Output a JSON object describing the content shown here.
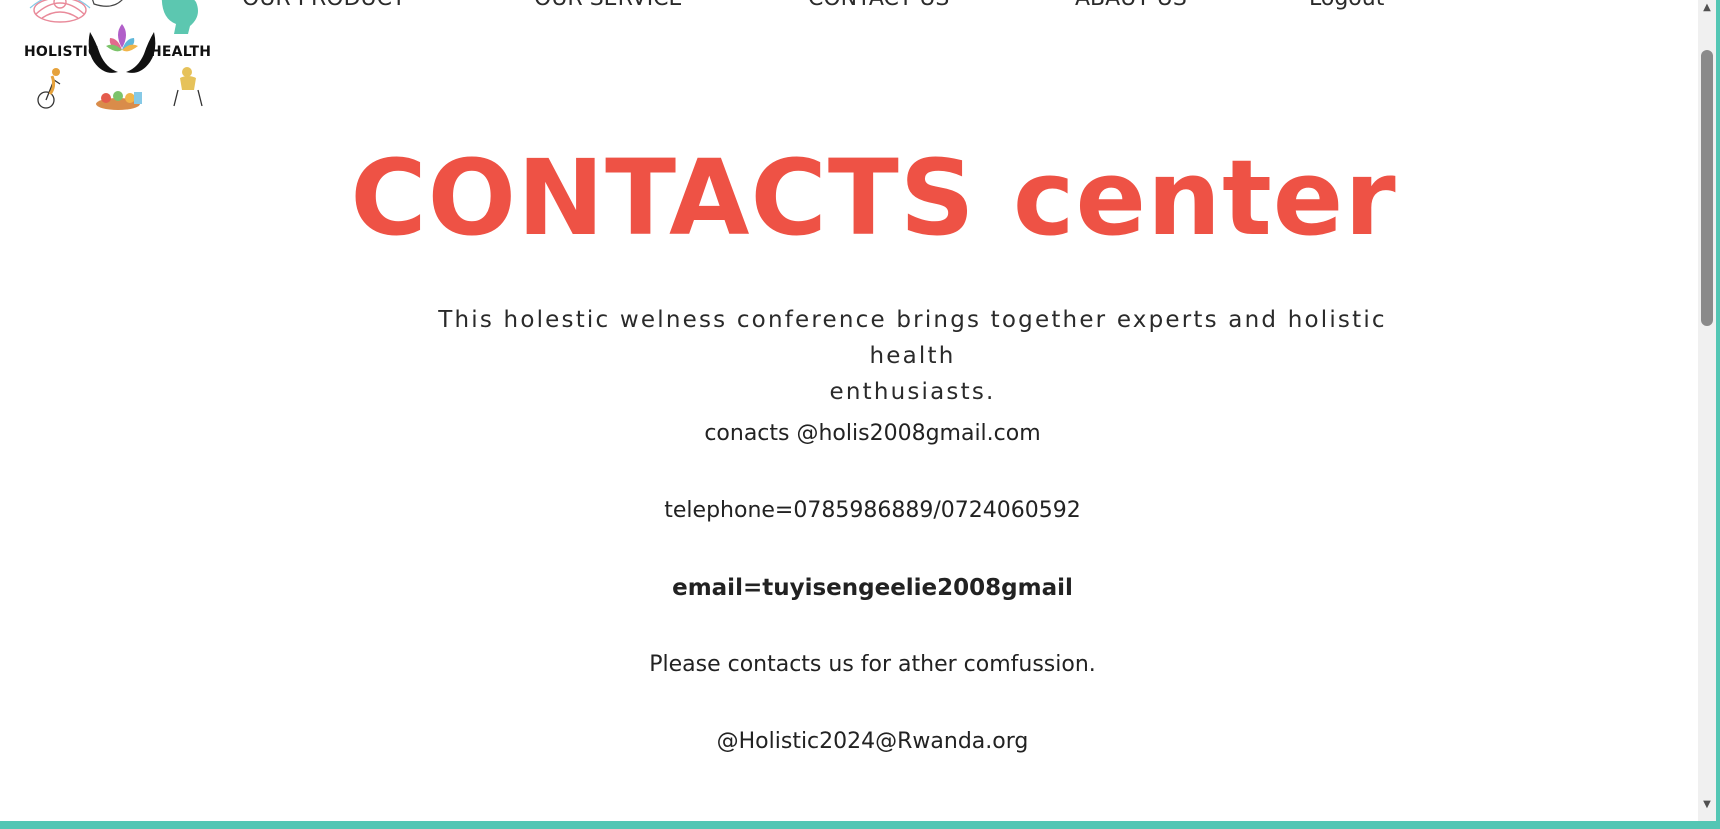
{
  "logo": {
    "left_word": "HOLISTIC",
    "right_word": "HEALTH",
    "icon": "holistic-health-logo"
  },
  "nav": {
    "items": [
      {
        "label": "OUR PRODUCT"
      },
      {
        "label": "OUR SERVICE"
      },
      {
        "label": "CONTACT US"
      },
      {
        "label": "ABAUT US"
      },
      {
        "label": "Logout"
      }
    ]
  },
  "main": {
    "title": "CONTACTS center",
    "intro_line1": "This holestic welness conference brings together experts and holistic health",
    "intro_line2": "enthusiasts.",
    "contact_email": "conacts @holis2008gmail.com",
    "telephone": "telephone=0785986889/0724060592",
    "email": "email=tuyisengeelie2008gmail",
    "note": "Please contacts us for ather comfussion.",
    "handle": "@Holistic2024@Rwanda.org"
  },
  "colors": {
    "title": "#ee5245",
    "frame": "#53c6b4",
    "text": "#222222"
  }
}
